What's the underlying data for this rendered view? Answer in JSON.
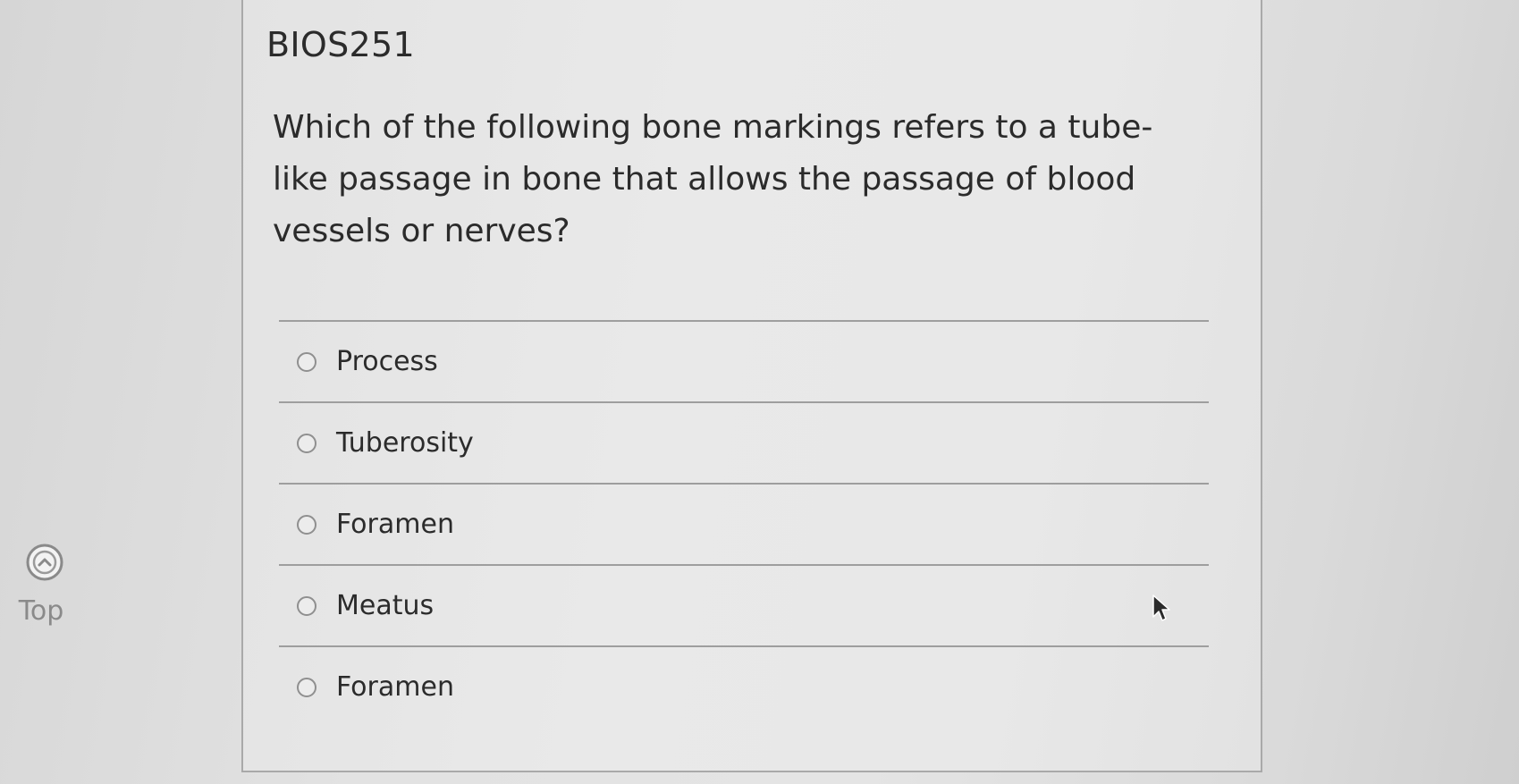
{
  "course": {
    "title": "BIOS251"
  },
  "question": {
    "text": "Which of the following bone markings refers to a tube-like passage in bone that allows the passage of blood vessels or nerves?",
    "options": [
      {
        "label": "Process",
        "selected": false
      },
      {
        "label": "Tuberosity",
        "selected": false
      },
      {
        "label": "Foramen",
        "selected": false
      },
      {
        "label": "Meatus",
        "selected": false
      },
      {
        "label": "Foramen",
        "selected": false
      }
    ]
  },
  "nav": {
    "top_label": "Top",
    "top_icon": "chevron-up-circle-icon"
  },
  "colors": {
    "text": "#2b2b2b",
    "muted": "#8a8a8a",
    "divider": "#9e9e9e",
    "card_border": "#a9a9a9"
  }
}
